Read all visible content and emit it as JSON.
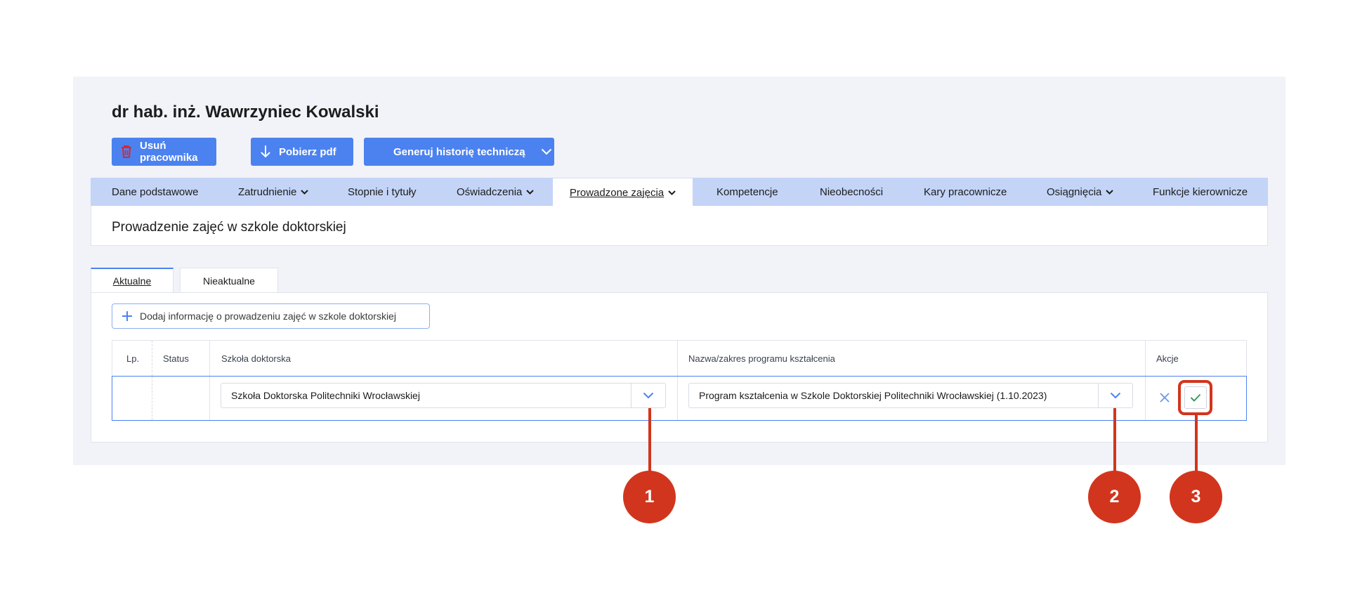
{
  "employee": {
    "name": "dr hab. inż. Wawrzyniec Kowalski"
  },
  "actions": {
    "delete_label": "Usuń pracownika",
    "pdf_label": "Pobierz pdf",
    "history_label": "Generuj historię techniczą"
  },
  "nav": {
    "items": [
      {
        "label": "Dane podstawowe"
      },
      {
        "label": "Zatrudnienie"
      },
      {
        "label": "Stopnie i tytuły"
      },
      {
        "label": "Oświadczenia"
      },
      {
        "label": "Prowadzone zajęcia"
      },
      {
        "label": "Kompetencje"
      },
      {
        "label": "Nieobecności"
      },
      {
        "label": "Kary pracownicze"
      },
      {
        "label": "Osiągnięcia"
      },
      {
        "label": "Funkcje kierownicze"
      }
    ]
  },
  "section": {
    "title": "Prowadzenie zajęć w szkole doktorskiej"
  },
  "tabs": [
    {
      "label": "Aktualne"
    },
    {
      "label": "Nieaktualne"
    }
  ],
  "add_button": {
    "label": "Dodaj informację o prowadzeniu zajęć w szkole doktorskiej"
  },
  "table": {
    "headers": [
      "Lp.",
      "Status",
      "Szkoła doktorska",
      "Nazwa/zakres programu kształcenia",
      "Akcje"
    ],
    "row": {
      "school": "Szkoła Doktorska Politechniki Wrocławskiej",
      "program": "Program kształcenia w Szkole Doktorskiej Politechniki Wrocławskiej (1.10.2023)"
    }
  },
  "callouts": [
    "1",
    "2",
    "3"
  ],
  "colors": {
    "accent": "#4b82f0",
    "nav_bg": "#c3d4f7",
    "callout": "#d2351d",
    "panel_bg": "#f2f3f8"
  }
}
